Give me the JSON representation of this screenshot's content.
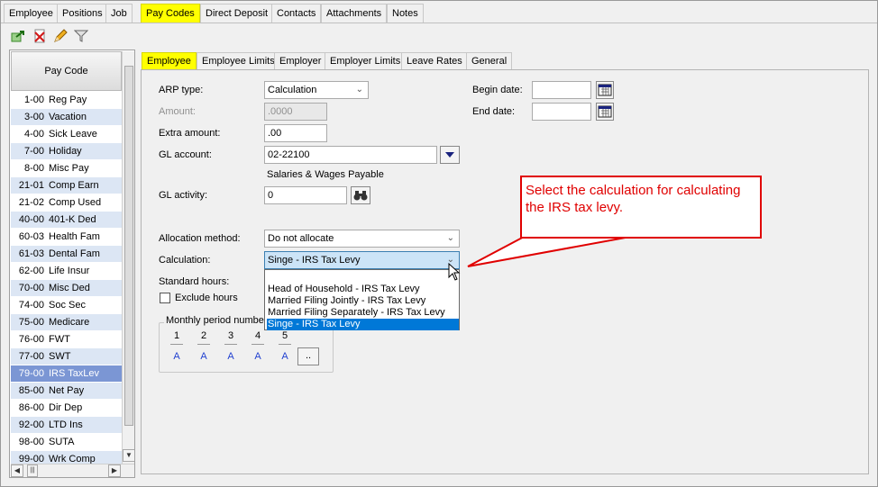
{
  "top_tabs": [
    {
      "label": "Employee",
      "active": false
    },
    {
      "label": "Positions",
      "active": false
    },
    {
      "label": "Job",
      "active": false
    },
    {
      "label": "Pay Codes",
      "active": true
    },
    {
      "label": "Direct Deposit",
      "active": false
    },
    {
      "label": "Contacts",
      "active": false
    },
    {
      "label": "Attachments",
      "active": false
    },
    {
      "label": "Notes",
      "active": false
    }
  ],
  "list": {
    "header": "Pay Code",
    "rows": [
      {
        "code": "1-00",
        "name": "Reg Pay"
      },
      {
        "code": "3-00",
        "name": "Vacation"
      },
      {
        "code": "4-00",
        "name": "Sick Leave"
      },
      {
        "code": "7-00",
        "name": "Holiday"
      },
      {
        "code": "8-00",
        "name": "Misc Pay"
      },
      {
        "code": "21-01",
        "name": "Comp Earn"
      },
      {
        "code": "21-02",
        "name": "Comp Used"
      },
      {
        "code": "40-00",
        "name": "401-K Ded"
      },
      {
        "code": "60-03",
        "name": "Health Fam"
      },
      {
        "code": "61-03",
        "name": "Dental Fam"
      },
      {
        "code": "62-00",
        "name": "Life Insur"
      },
      {
        "code": "70-00",
        "name": "Misc Ded"
      },
      {
        "code": "74-00",
        "name": "Soc Sec"
      },
      {
        "code": "75-00",
        "name": "Medicare"
      },
      {
        "code": "76-00",
        "name": "FWT"
      },
      {
        "code": "77-00",
        "name": "SWT"
      },
      {
        "code": "79-00",
        "name": "IRS TaxLev"
      },
      {
        "code": "85-00",
        "name": "Net Pay"
      },
      {
        "code": "86-00",
        "name": "Dir Dep"
      },
      {
        "code": "92-00",
        "name": "LTD Ins"
      },
      {
        "code": "98-00",
        "name": "SUTA"
      },
      {
        "code": "99-00",
        "name": "Wrk Comp"
      }
    ],
    "selected_index": 16
  },
  "sub_tabs": [
    {
      "label": "Employee",
      "active": true
    },
    {
      "label": "Employee Limits",
      "active": false
    },
    {
      "label": "Employer",
      "active": false
    },
    {
      "label": "Employer Limits",
      "active": false
    },
    {
      "label": "Leave Rates",
      "active": false
    },
    {
      "label": "General",
      "active": false
    }
  ],
  "form": {
    "arp_type_label": "ARP type:",
    "arp_type_value": "Calculation",
    "amount_label": "Amount:",
    "amount_value": ".0000",
    "extra_amount_label": "Extra amount:",
    "extra_amount_value": ".00",
    "gl_account_label": "GL account:",
    "gl_account_value": "02-22100",
    "gl_account_desc": "Salaries & Wages Payable",
    "gl_activity_label": "GL activity:",
    "gl_activity_value": "0",
    "allocation_label": "Allocation method:",
    "allocation_value": "Do not allocate",
    "calculation_label": "Calculation:",
    "calculation_value": "Singe - IRS Tax Levy",
    "standard_hours_label": "Standard hours:",
    "exclude_hours_label": "Exclude hours",
    "begin_date_label": "Begin date:",
    "end_date_label": "End date:",
    "monthly_label": "Monthly period number",
    "periods": [
      "1",
      "2",
      "3",
      "4",
      "5"
    ],
    "period_values": [
      "A",
      "A",
      "A",
      "A",
      "A"
    ],
    "more_button": ".."
  },
  "calculation_options": [
    "",
    "Head of Household - IRS Tax Levy",
    "Married Filing Jointly - IRS Tax Levy",
    "Married Filing Separately - IRS Tax Levy",
    "Singe - IRS Tax Levy"
  ],
  "callout_text": "Select the calculation for calculating the IRS tax levy.",
  "colors": {
    "active_tab": "#ffff00",
    "selected_row": "#7b96d4",
    "alt_row": "#dce6f4",
    "dropdown_highlight": "#0078d7",
    "callout": "#e00000"
  }
}
